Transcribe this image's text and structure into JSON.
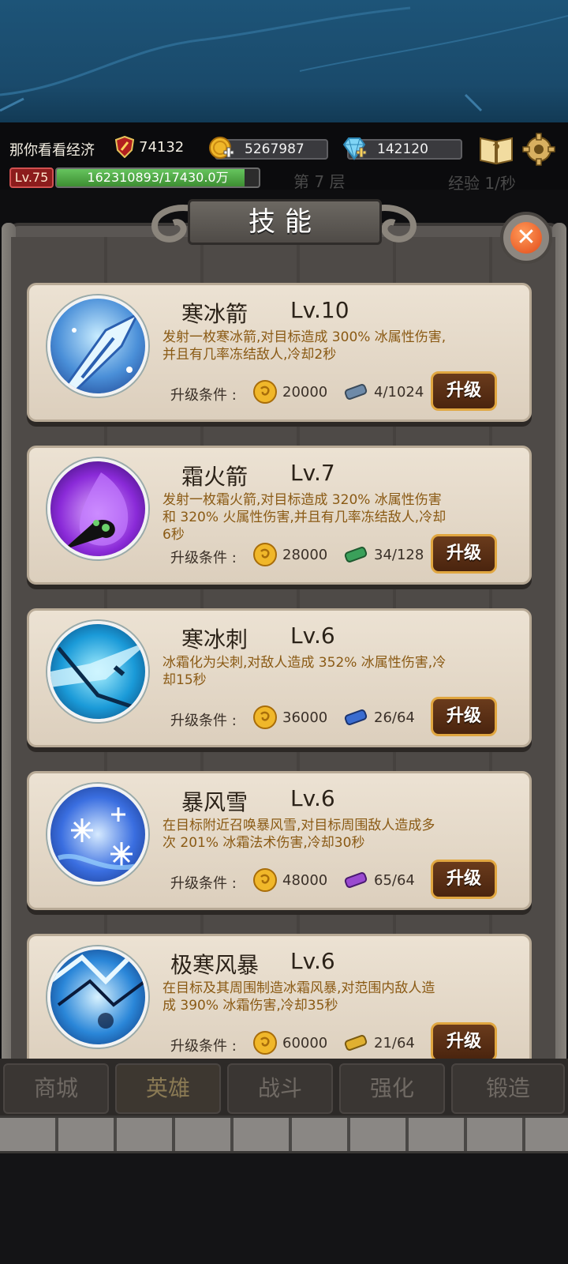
{
  "header": {
    "player_name": "那你看看经济",
    "power": "74132",
    "gold": "5267987",
    "gems": "142120",
    "level_badge": "Lv.75",
    "exp_text": "162310893/17430.0万",
    "exp_progress": 0.93,
    "floor_text": "第 7 层",
    "rate_text": "经验 1/秒"
  },
  "panel": {
    "title": "技能"
  },
  "skills": [
    {
      "name": "寒冰箭",
      "level": "Lv.10",
      "desc": "发射一枚寒冰箭,对目标造成 300% 冰属性伤害,并且有几率冻结敌人,冷却2秒",
      "req_label": "升级条件 :",
      "coin_cost": "20000",
      "scroll_progress": "4/1024",
      "scroll_color": "#6e8aa8",
      "upgrade_label": "升级"
    },
    {
      "name": "霜火箭",
      "level": "Lv.7",
      "desc": "发射一枚霜火箭,对目标造成 320% 冰属性伤害和 320% 火属性伤害,并且有几率冻结敌人,冷却6秒",
      "req_label": "升级条件 :",
      "coin_cost": "28000",
      "scroll_progress": "34/128",
      "scroll_color": "#3aa05a",
      "upgrade_label": "升级"
    },
    {
      "name": "寒冰刺",
      "level": "Lv.6",
      "desc": "冰霜化为尖刺,对敌人造成 352% 冰属性伤害,冷却15秒",
      "req_label": "升级条件 :",
      "coin_cost": "36000",
      "scroll_progress": "26/64",
      "scroll_color": "#3a6cd0",
      "upgrade_label": "升级"
    },
    {
      "name": "暴风雪",
      "level": "Lv.6",
      "desc": "在目标附近召唤暴风雪,对目标周围敌人造成多次 201% 冰霜法术伤害,冷却30秒",
      "req_label": "升级条件 :",
      "coin_cost": "48000",
      "scroll_progress": "65/64",
      "scroll_color": "#9a4ad0",
      "upgrade_label": "升级"
    },
    {
      "name": "极寒风暴",
      "level": "Lv.6",
      "desc": "在目标及其周围制造冰霜风暴,对范围内敌人造成 390% 冰霜伤害,冷却35秒",
      "req_label": "升级条件 :",
      "coin_cost": "60000",
      "scroll_progress": "21/64",
      "scroll_color": "#e0b030",
      "upgrade_label": "升级"
    }
  ],
  "nav": {
    "items": [
      "商城",
      "英雄",
      "战斗",
      "强化",
      "锻造"
    ],
    "active": "英雄"
  },
  "colors": {
    "accent_gold": "#e0a640",
    "desc_text": "#8a5a14",
    "card_bg": "#ece2d3"
  }
}
